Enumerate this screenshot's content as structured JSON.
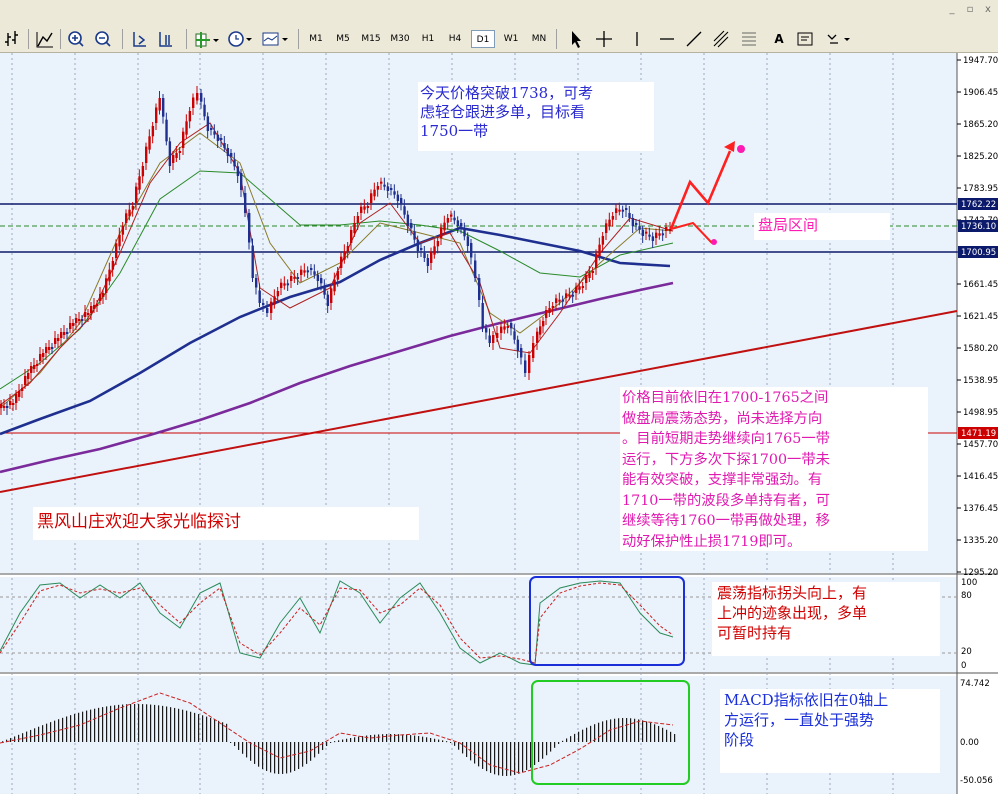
{
  "window": {
    "min_label": "_",
    "max_label": "▫",
    "close_label": "x"
  },
  "toolbar": {
    "timeframes": [
      "M1",
      "M5",
      "M15",
      "M30",
      "H1",
      "H4",
      "D1",
      "W1",
      "MN"
    ],
    "active_timeframe": "D1",
    "text_tool_label": "A"
  },
  "price_axis": {
    "ticks": [
      "1947.70",
      "1906.45",
      "1865.20",
      "1825.20",
      "1783.95",
      "1742.70",
      "1701.45",
      "1661.45",
      "1621.45",
      "1580.20",
      "1538.95",
      "1498.95",
      "1457.70",
      "1416.45",
      "1376.45",
      "1335.20",
      "1295.20"
    ],
    "tags": [
      {
        "label": "1762.22",
        "color": "#0c1a6b"
      },
      {
        "label": "1736.10",
        "color": "#0c1a6b"
      },
      {
        "label": "1700.95",
        "color": "#0c1a6b"
      },
      {
        "label": "1471.19",
        "color": "#cc0000"
      }
    ]
  },
  "stoch_axis": {
    "ticks": [
      "100",
      "80",
      "20",
      "0"
    ]
  },
  "macd_axis": {
    "ticks": [
      "74.742",
      "0.00",
      "-50.056"
    ]
  },
  "annotations": {
    "top_note": "今天价格突破1738，可考\n虑轻仓跟进多单，目标看\n1750一带",
    "range_label": "盘局区间",
    "analysis": "价格目前依旧在1700-1765之间\n做盘局震荡态势，尚未选择方向\n。目前短期走势继续向1765一带\n运行，下方多次下探1700一带未\n能有效突破，支撑非常强劲。有\n1710一带的波段多单持有者，可\n继续等待1760一带再做处理，移\n动好保护性止损1719即可。",
    "welcome": "黑风山庄欢迎大家光临探讨",
    "stoch_note": "震荡指标拐头向上，有\n上冲的迹象出现，多单\n可暂时持有",
    "macd_note": "MACD指标依旧在0轴上\n方运行，一直处于强势\n阶段"
  },
  "colors": {
    "chart_bg": "#eaf3fb",
    "bull_candle": "#cc0000",
    "bear_candle": "#1f2f8f",
    "resistance_line": "#0c1a6b",
    "trend_line": "#c01010",
    "ma_long": "#1f2f8f",
    "ma_longest": "#7a2a9a",
    "stoch_box": "#1a2fd8",
    "macd_box": "#22cc22"
  }
}
